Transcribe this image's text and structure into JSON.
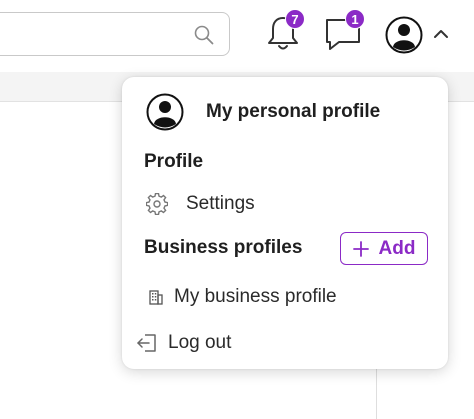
{
  "header": {
    "notifications_count": "7",
    "messages_count": "1",
    "accent_color": "#8b2ac6"
  },
  "menu": {
    "personal_profile": "My personal profile",
    "profile_heading": "Profile",
    "settings": "Settings",
    "business_heading": "Business profiles",
    "add_label": "Add",
    "business_profile": "My business profile",
    "logout": "Log out"
  },
  "icons": [
    "search-icon",
    "bell-icon",
    "chat-icon",
    "avatar-icon",
    "chevron-up-icon",
    "gear-icon",
    "plus-icon",
    "building-icon",
    "logout-icon"
  ]
}
